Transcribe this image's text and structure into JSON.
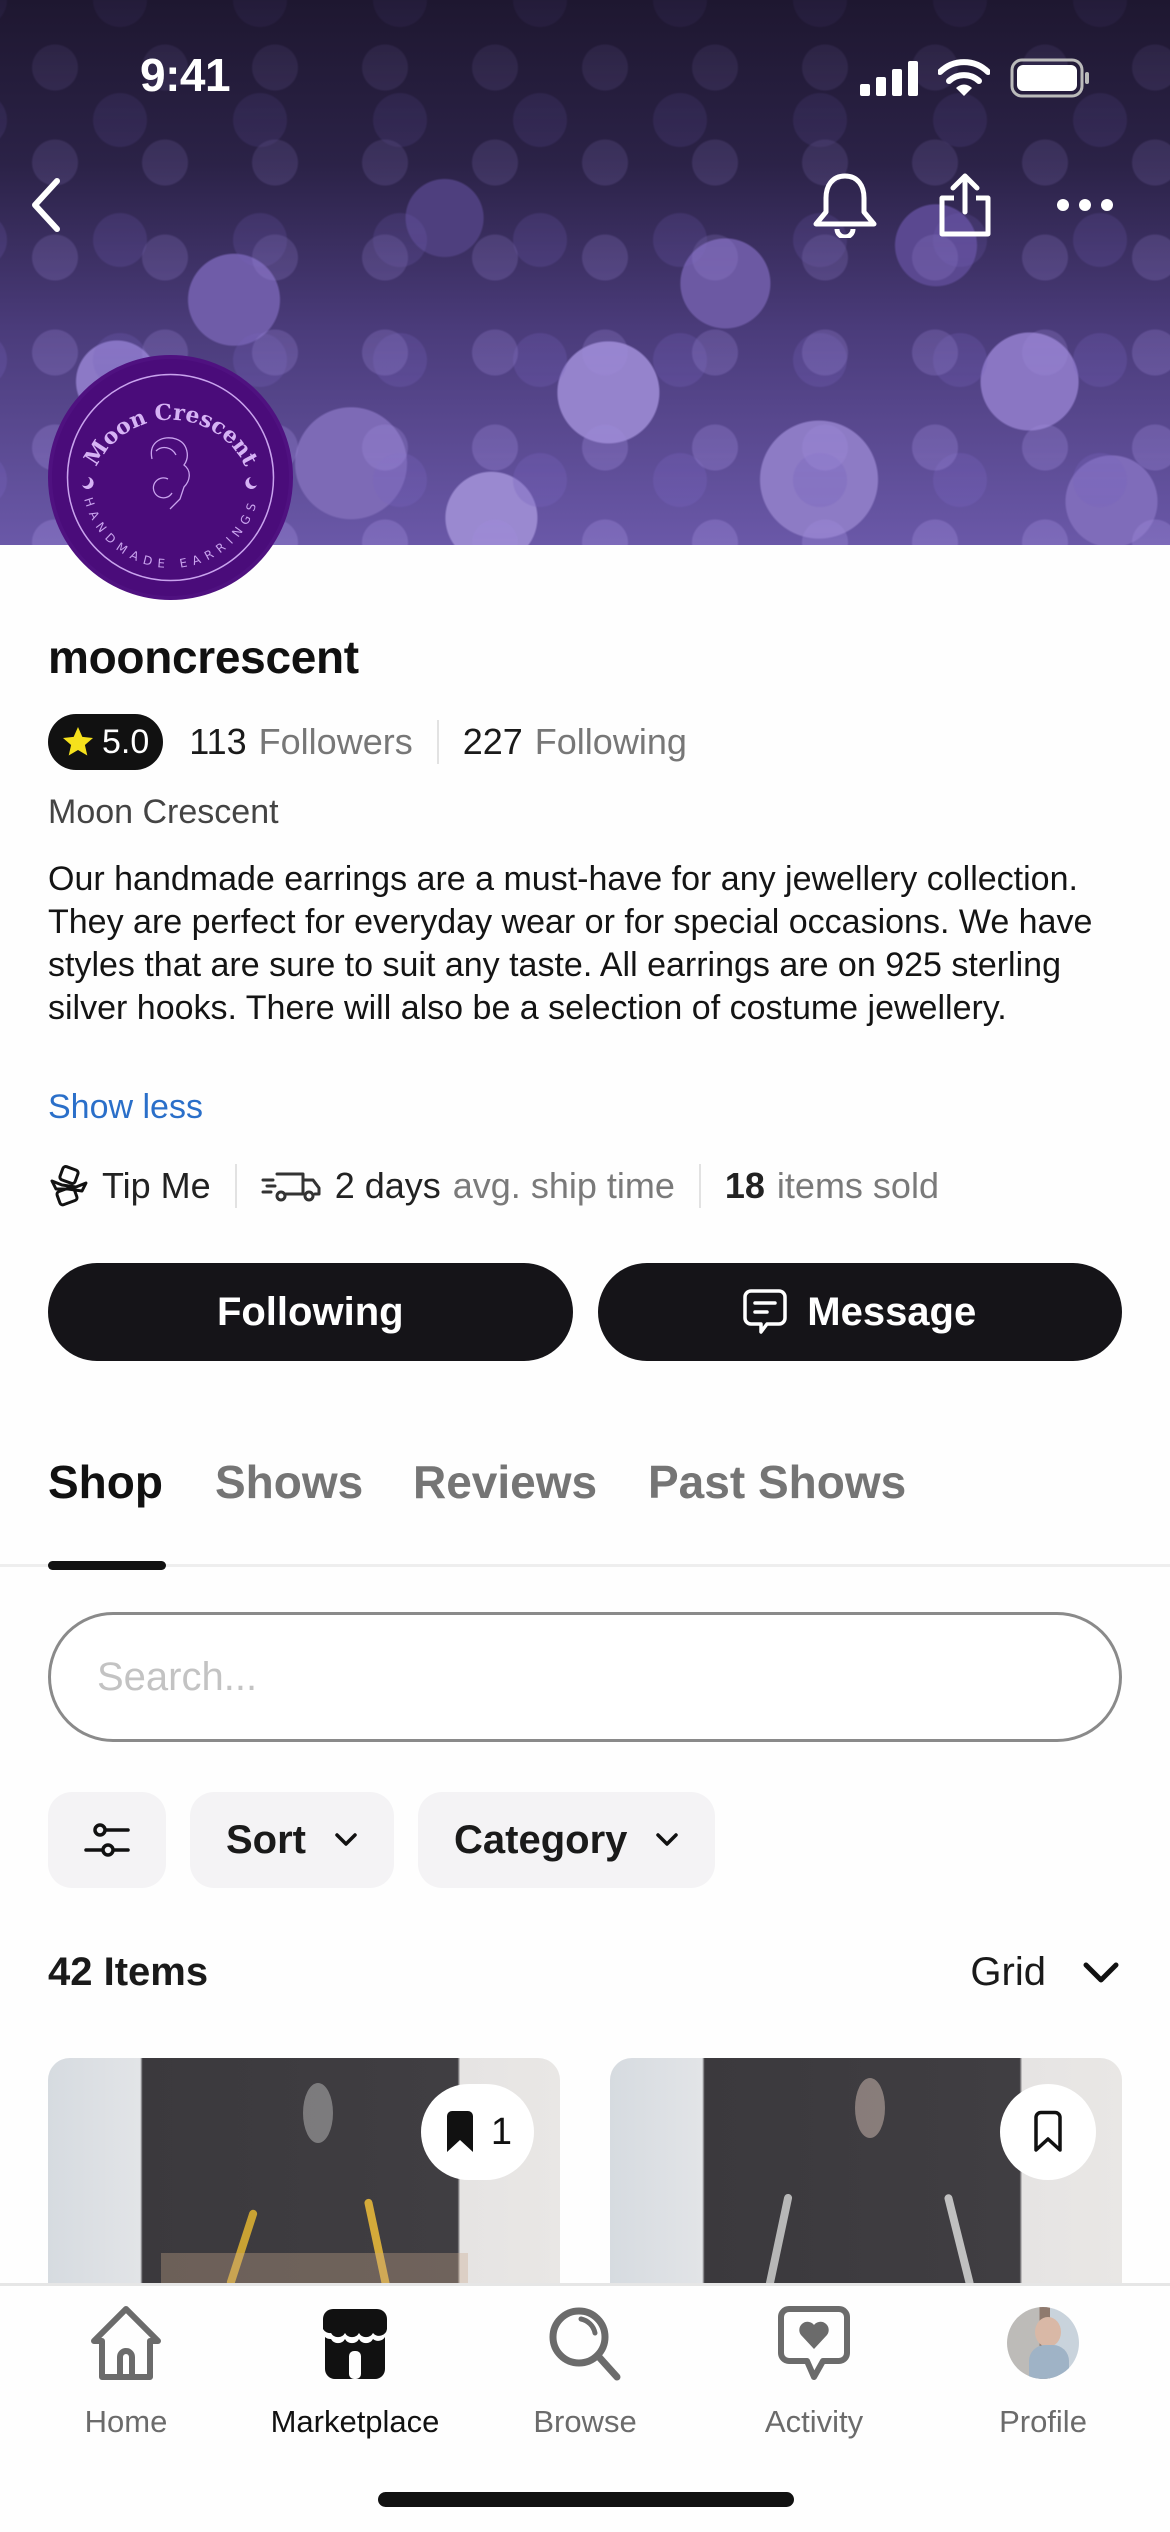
{
  "status_bar": {
    "time": "9:41"
  },
  "header": {
    "back_icon": "chevron-left-icon",
    "actions": [
      "bell-icon",
      "share-icon",
      "more-icon"
    ]
  },
  "avatar": {
    "brand_name": "Moon Crescent",
    "tagline": "HANDMADE EARRINGS",
    "colors": {
      "background": "#4a0c7a",
      "ink": "#c9a3ee"
    }
  },
  "profile": {
    "username": "mooncrescent",
    "rating": "5.0",
    "followers_count": "113",
    "followers_label": "Followers",
    "following_count": "227",
    "following_label": "Following",
    "display_name": "Moon Crescent",
    "bio": "Our handmade earrings are a must-have for any jewellery collection. They are perfect for everyday wear or for special occasions. We have styles that are sure to suit any taste. All earrings are on 925 sterling silver hooks. There will also be a selection of costume jewellery.",
    "show_less_label": "Show less",
    "link_color": "#2a6fc9"
  },
  "meta": {
    "tip_label": "Tip Me",
    "ship_value": "2 days",
    "ship_label": "avg. ship time",
    "sold_value": "18",
    "sold_label": "items sold"
  },
  "actions": {
    "following_label": "Following",
    "message_label": "Message"
  },
  "tabs": [
    {
      "label": "Shop",
      "active": true
    },
    {
      "label": "Shows",
      "active": false
    },
    {
      "label": "Reviews",
      "active": false
    },
    {
      "label": "Past Shows",
      "active": false
    }
  ],
  "search": {
    "placeholder": "Search...",
    "value": ""
  },
  "filters": {
    "filter_icon": "sliders-icon",
    "sort_label": "Sort",
    "category_label": "Category"
  },
  "listing": {
    "count_label": "42 Items",
    "view_label": "Grid"
  },
  "products": [
    {
      "saved": true,
      "save_count": "1",
      "hook_color": "gold"
    },
    {
      "saved": false,
      "save_count": "",
      "hook_color": "silver"
    }
  ],
  "bottom_nav": [
    {
      "label": "Home",
      "icon": "home-icon",
      "active": false
    },
    {
      "label": "Marketplace",
      "icon": "storefront-icon",
      "active": true
    },
    {
      "label": "Browse",
      "icon": "search-icon",
      "active": false
    },
    {
      "label": "Activity",
      "icon": "activity-heart-icon",
      "active": false
    },
    {
      "label": "Profile",
      "icon": "profile-avatar",
      "active": false
    }
  ]
}
